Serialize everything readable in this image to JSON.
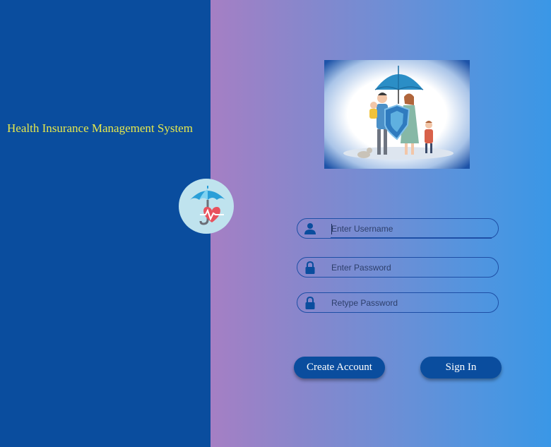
{
  "app": {
    "title": "Health Insurance Management System"
  },
  "colors": {
    "left_panel": "#0a4d9e",
    "gradient_start": "#a57fc4",
    "gradient_end": "#3a97e6",
    "title": "#e6e84c",
    "button": "#0a4d9e"
  },
  "logo": {
    "icon": "umbrella-heart-icon"
  },
  "hero": {
    "icon": "family-umbrella-illustration"
  },
  "form": {
    "username": {
      "placeholder": "Enter Username",
      "value": "",
      "icon": "user-icon"
    },
    "password": {
      "placeholder": "Enter Password",
      "value": "",
      "icon": "lock-icon"
    },
    "retype_password": {
      "placeholder": "Retype Password",
      "value": "",
      "icon": "lock-icon"
    }
  },
  "buttons": {
    "create_account": "Create Account",
    "sign_in": "Sign In"
  }
}
